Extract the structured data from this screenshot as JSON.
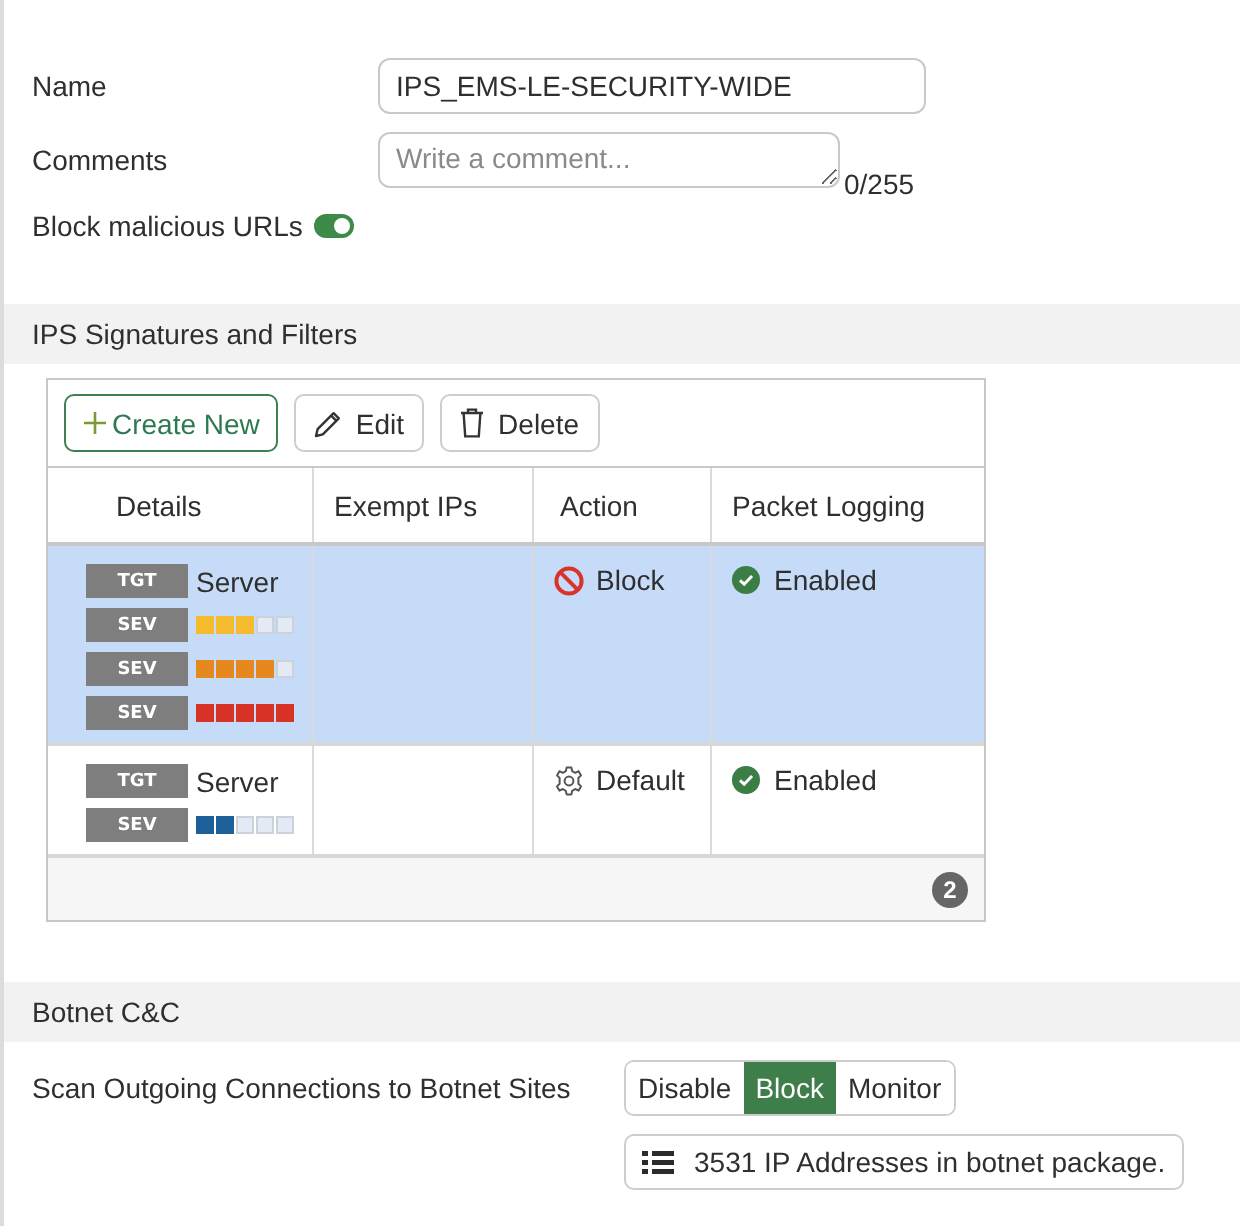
{
  "form": {
    "fields": [
      {
        "kind": "text",
        "label": "Name",
        "value": "IPS_EMS-LE-SECURITY-WIDE"
      },
      {
        "kind": "textarea",
        "label": "Comments",
        "placeholder": "Write a comment...",
        "counter": "0/255"
      },
      {
        "kind": "toggle",
        "label": "Block malicious URLs",
        "on": true
      }
    ]
  },
  "ips_section": {
    "title": "IPS Signatures and Filters",
    "toolbar": [
      {
        "kind": "create",
        "label": "Create New"
      },
      {
        "kind": "edit",
        "label": "Edit"
      },
      {
        "kind": "delete",
        "label": "Delete"
      }
    ],
    "table": {
      "columns": [
        "Details",
        "Exempt IPs",
        "Action",
        "Packet Logging"
      ],
      "rows": [
        {
          "selected": true,
          "details": [
            {
              "kind": "target",
              "tag": "TGT",
              "text": "Server"
            },
            {
              "kind": "severity",
              "tag": "SEV",
              "stars": 3,
              "color": "#f4bb2c"
            },
            {
              "kind": "severity",
              "tag": "SEV",
              "stars": 4,
              "color": "#e5891e"
            },
            {
              "kind": "severity",
              "tag": "SEV",
              "stars": 5,
              "color": "#d83226"
            }
          ],
          "action": {
            "kind": "block",
            "label": "Block"
          },
          "packet_logging": {
            "kind": "enabled",
            "label": "Enabled"
          }
        },
        {
          "selected": false,
          "details": [
            {
              "kind": "target",
              "tag": "TGT",
              "text": "Server"
            },
            {
              "kind": "severity",
              "tag": "SEV",
              "stars": 2,
              "color": "#1d5f98"
            }
          ],
          "action": {
            "kind": "default",
            "label": "Default"
          },
          "packet_logging": {
            "kind": "enabled",
            "label": "Enabled"
          }
        }
      ],
      "count": "2"
    }
  },
  "botnet_section": {
    "title": "Botnet C&C",
    "label": "Scan Outgoing Connections to Botnet Sites",
    "options": [
      {
        "label": "Disable",
        "selected": false
      },
      {
        "label": "Block",
        "selected": true
      },
      {
        "label": "Monitor",
        "selected": false
      }
    ],
    "package_button": "3531 IP Addresses in botnet package."
  }
}
